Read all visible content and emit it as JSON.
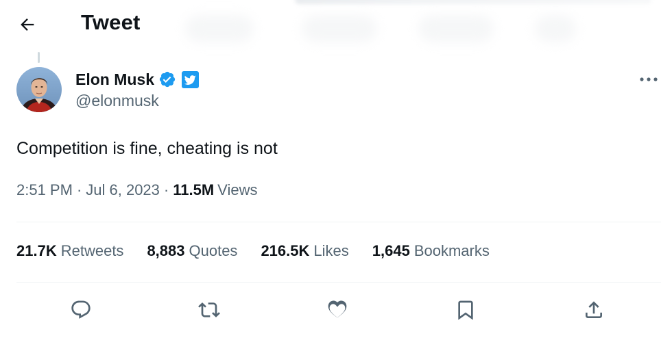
{
  "header": {
    "title": "Tweet",
    "back_icon": "arrow-left-icon"
  },
  "tweet": {
    "author": {
      "name": "Elon Musk",
      "handle": "@elonmusk",
      "verified_icon": "verified-badge-icon",
      "affiliate_icon": "twitter-bird-badge-icon",
      "verified_color": "#1d9bf0"
    },
    "text": "Competition is fine, cheating is not",
    "time": "2:51 PM",
    "date": "Jul 6, 2023",
    "separator": "·",
    "views_count": "11.5M",
    "views_label": "Views"
  },
  "stats": [
    {
      "count": "21.7K",
      "label": "Retweets"
    },
    {
      "count": "8,883",
      "label": "Quotes"
    },
    {
      "count": "216.5K",
      "label": "Likes"
    },
    {
      "count": "1,645",
      "label": "Bookmarks"
    }
  ],
  "actions": [
    {
      "name": "reply-button",
      "icon": "reply-icon"
    },
    {
      "name": "retweet-button",
      "icon": "retweet-icon"
    },
    {
      "name": "like-button",
      "icon": "heart-icon"
    },
    {
      "name": "bookmark-button",
      "icon": "bookmark-icon"
    },
    {
      "name": "share-button",
      "icon": "share-icon"
    }
  ],
  "colors": {
    "text_primary": "#0f1419",
    "text_secondary": "#536471",
    "accent": "#1d9bf0",
    "divider": "#eff3f4"
  }
}
